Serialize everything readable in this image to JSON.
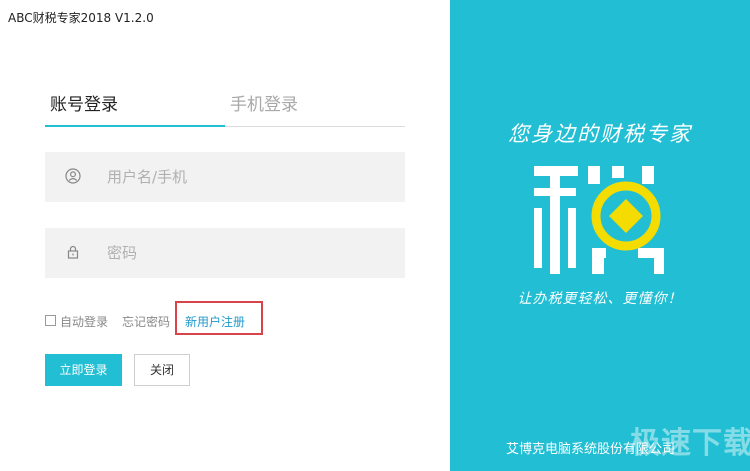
{
  "window": {
    "title": "ABC财税专家2018 V1.2.0"
  },
  "tabs": [
    {
      "label": "账号登录",
      "active": true
    },
    {
      "label": "手机登录",
      "active": false
    }
  ],
  "form": {
    "username": {
      "placeholder": "用户名/手机",
      "value": "",
      "icon": "user-icon"
    },
    "password": {
      "placeholder": "密码",
      "value": "",
      "icon": "lock-icon"
    }
  },
  "options": {
    "auto_login_label": "自动登录",
    "auto_login_checked": false,
    "forgot_password": "忘记密码",
    "register": "新用户注册"
  },
  "buttons": {
    "login": "立即登录",
    "close": "关闭"
  },
  "brand_panel": {
    "slogan_top": "您身边的财税专家",
    "logo_char": "税",
    "slogan_bottom": "让办税更轻松、更懂你！",
    "company": "艾博克电脑系统股份有限公司",
    "watermark": "极速下载站"
  },
  "colors": {
    "accent": "#22bfd4",
    "link": "#2299cc",
    "highlight": "#d9434a",
    "logo_coin": "#f4dc00"
  }
}
